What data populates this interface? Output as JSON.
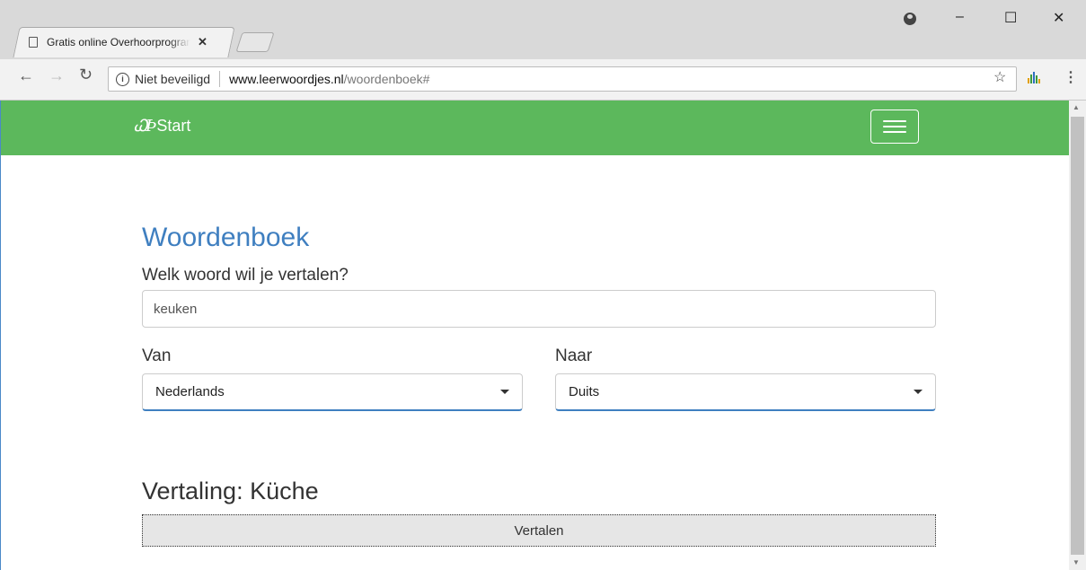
{
  "browser": {
    "tab_title": "Gratis online Overhoorprogramma",
    "tab_close": "✕",
    "security_label": "Niet beveiligd",
    "url_host": "www.leerwoordjes.nl",
    "url_path": "/woordenboek#",
    "window_controls": {
      "minimize": "–",
      "maximize": "☐",
      "close": "✕"
    }
  },
  "navbar": {
    "brand_logo": "𝓌",
    "brand_label": "Start",
    "background_color": "#5cb85c"
  },
  "main": {
    "title": "Woordenboek",
    "prompt": "Welk woord wil je vertalen?",
    "word_value": "keuken",
    "from_label": "Van",
    "from_value": "Nederlands",
    "to_label": "Naar",
    "to_value": "Duits",
    "result": "Vertaling: Küche",
    "translate_button": "Vertalen"
  },
  "colors": {
    "accent": "#3f7fc0",
    "navbar": "#5cb85c"
  }
}
